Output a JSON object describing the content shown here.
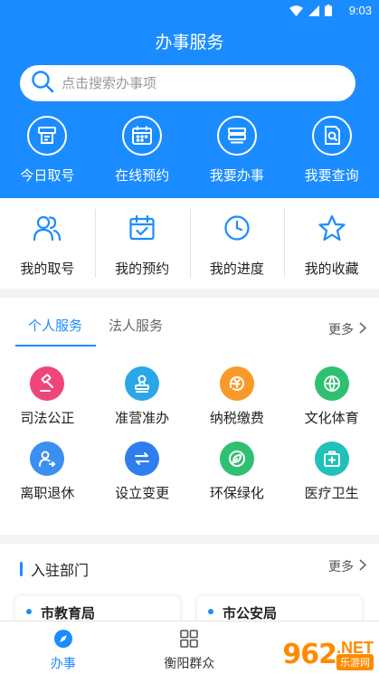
{
  "status_bar": {
    "time": "9:03"
  },
  "header": {
    "title": "办事服务"
  },
  "search": {
    "placeholder": "点击搜索办事项"
  },
  "quick_actions": [
    {
      "label": "今日取号",
      "icon": "ticket-icon"
    },
    {
      "label": "在线预约",
      "icon": "calendar-icon"
    },
    {
      "label": "我要办事",
      "icon": "documents-icon"
    },
    {
      "label": "我要查询",
      "icon": "query-icon"
    }
  ],
  "my_items": [
    {
      "label": "我的取号",
      "icon": "users-icon"
    },
    {
      "label": "我的预约",
      "icon": "calendar-check-icon"
    },
    {
      "label": "我的进度",
      "icon": "clock-icon"
    },
    {
      "label": "我的收藏",
      "icon": "star-icon"
    }
  ],
  "services": {
    "tabs": [
      "个人服务",
      "法人服务"
    ],
    "active_tab": "个人服务",
    "more_label": "更多",
    "items": [
      {
        "label": "司法公正",
        "icon": "gavel-icon",
        "color": "#f0457a"
      },
      {
        "label": "准营准办",
        "icon": "stamp-icon",
        "color": "#2aa7e8"
      },
      {
        "label": "纳税缴费",
        "icon": "yuan-refresh-icon",
        "color": "#f89a2a"
      },
      {
        "label": "文化体育",
        "icon": "basketball-icon",
        "color": "#2fc071"
      },
      {
        "label": "离职退休",
        "icon": "person-exit-icon",
        "color": "#3a8ff2"
      },
      {
        "label": "设立变更",
        "icon": "swap-icon",
        "color": "#2f7ef0"
      },
      {
        "label": "环保绿化",
        "icon": "leaf-icon",
        "color": "#2fc071"
      },
      {
        "label": "医疗卫生",
        "icon": "medical-kit-icon",
        "color": "#20c1b8"
      }
    ]
  },
  "departments": {
    "title": "入驻部门",
    "more_label": "更多",
    "items": [
      "市教育局",
      "市公安局"
    ]
  },
  "tab_bar": {
    "items": [
      {
        "label": "办事",
        "icon": "compass-icon"
      },
      {
        "label": "衡阳群众",
        "icon": "grid-icon"
      }
    ],
    "active": "办事"
  },
  "watermark": {
    "number": "962",
    "suffix": ".NET",
    "sub": "乐游网"
  },
  "colors": {
    "primary": "#1a8cff",
    "background": "#f2f3f5"
  }
}
